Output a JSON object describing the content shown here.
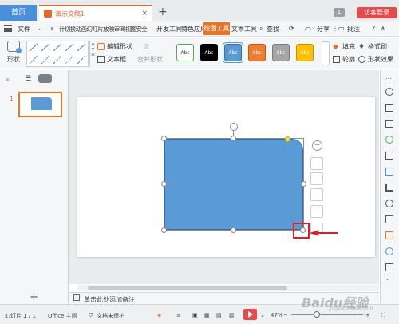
{
  "titlebar": {
    "home_tab": "首页",
    "doc_tab": "演示文稿1",
    "close_glyph": "×",
    "new_tab_glyph": "+",
    "badge": "1",
    "login_label": "访客登录"
  },
  "menubar": {
    "file_label": "文件",
    "more_glyph": "»",
    "items": [
      "计",
      "切",
      "换",
      "动",
      "画",
      "幻",
      "灯片放映",
      "审阅",
      "视图",
      "安全",
      "开发工具",
      "特色应用"
    ],
    "compressed_label": "计切换动画幻灯片放映审阅视图安全",
    "dev_tools": "开发工具",
    "special": "特色应用",
    "drawing_tools": "绘图工具",
    "text_tools": "文本工具",
    "search_label": "查找",
    "share_label": "分享",
    "comment_label": "批注"
  },
  "ribbon": {
    "shape_label": "形状",
    "edit_shape_label": "编辑形状",
    "textbox_label": "文本框",
    "merge_shape_label": "合并形状",
    "fill_label": "填充",
    "format_brush_label": "格式刷",
    "outline_label": "轮廓",
    "shape_effect_label": "形状效果",
    "swatches": [
      {
        "text": "Abc",
        "bg": "#ffffff",
        "fg": "#333333",
        "border": "#4caf50"
      },
      {
        "text": "Abc",
        "bg": "#000000",
        "fg": "#ffffff",
        "border": "#000000"
      },
      {
        "text": "Abc",
        "bg": "#5b9bd5",
        "fg": "#ffffff",
        "border": "#3c6ea0"
      },
      {
        "text": "Abc",
        "bg": "#ed7d31",
        "fg": "#ffffff",
        "border": "#c55a11"
      },
      {
        "text": "Abc",
        "bg": "#a5a5a5",
        "fg": "#ffffff",
        "border": "#7b7b7b"
      },
      {
        "text": "Abc",
        "bg": "#ffc000",
        "fg": "#ffffff",
        "border": "#bf9000"
      }
    ]
  },
  "left_panel": {
    "slide_number": "1",
    "add_glyph": "+"
  },
  "canvas": {
    "shape_fill": "#5b9bd5",
    "highlight_color": "#e02020"
  },
  "notes": {
    "placeholder": "单击此处添加备注"
  },
  "statusbar": {
    "slide_info": "幻灯片 1 / 1",
    "theme": "Office 主题",
    "doc_protect": "文档未保护",
    "zoom": "47%",
    "zoom_minus": "−",
    "zoom_plus": "+"
  },
  "watermark": {
    "text": "Baidu经验",
    "sub": "jingyan.baidu.com"
  }
}
